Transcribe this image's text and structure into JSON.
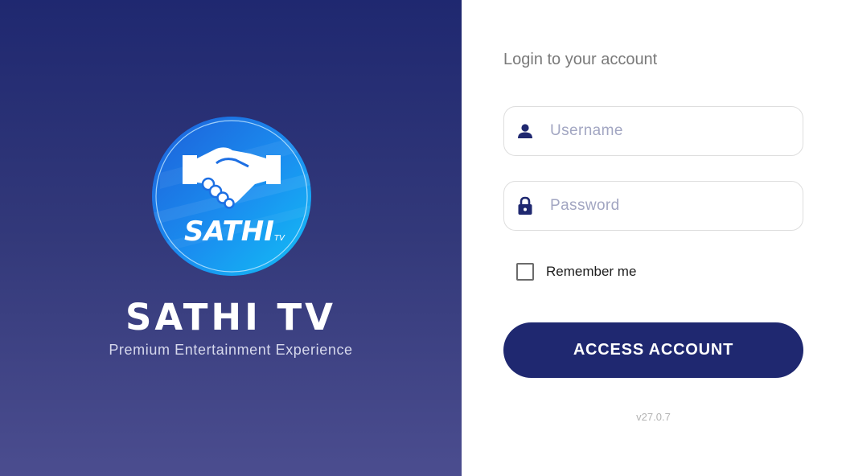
{
  "brand": {
    "logo_text": "SATHI",
    "logo_subtext": "TV",
    "title": "SATHI TV",
    "tagline": "Premium Entertainment Experience"
  },
  "login": {
    "heading": "Login to your account",
    "username_placeholder": "Username",
    "password_placeholder": "Password",
    "remember_label": "Remember me",
    "remember_checked": false,
    "submit_label": "ACCESS ACCOUNT",
    "version": "v27.0.7"
  },
  "colors": {
    "primary": "#1f2870",
    "panel_gradient_top": "#1f2870",
    "panel_gradient_bottom": "#4b4d8f",
    "logo_blue": "#1d6fe3",
    "logo_light_blue": "#1aa7f0"
  },
  "icons": {
    "username": "person-icon",
    "password": "lock-icon",
    "logo": "handshake-icon"
  }
}
